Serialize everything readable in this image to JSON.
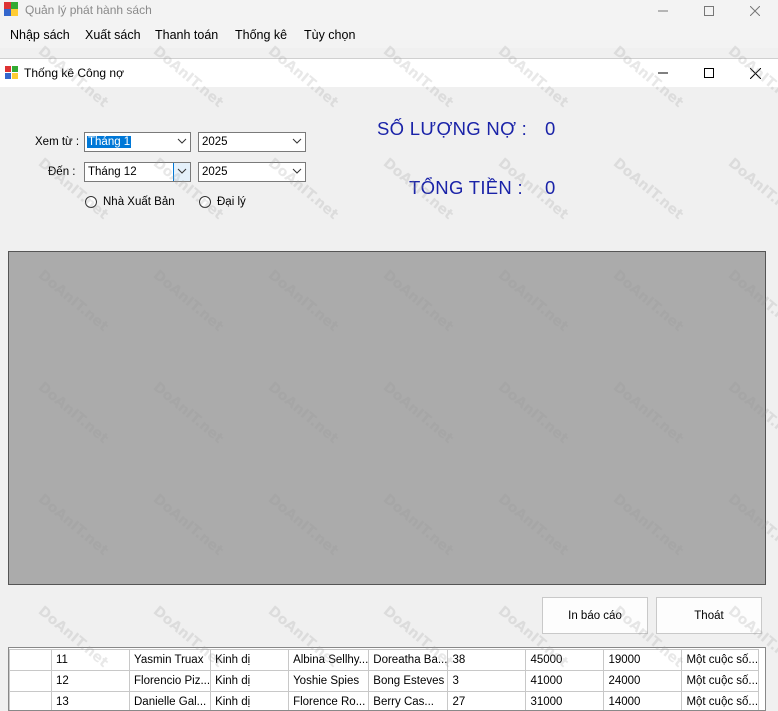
{
  "app": {
    "title": "Quản lý phát hành sách"
  },
  "menu": [
    "Nhập sách",
    "Xuất sách",
    "Thanh toán",
    "Thống kê",
    "Tùy chọn"
  ],
  "child": {
    "title": "Thống kê Công nợ"
  },
  "filter": {
    "from_label": "Xem từ :",
    "to_label": "Đến :",
    "from_month": "Tháng 1",
    "from_year": "2025",
    "to_month": "Tháng 12",
    "to_year": "2025",
    "radio_publisher": "Nhà Xuất Bản",
    "radio_agent": "Đại lý"
  },
  "summary": {
    "count_label": "SỐ LƯỢNG NỢ :",
    "count_value": "0",
    "total_label": "TỔNG TIỀN :",
    "total_value": "0"
  },
  "buttons": {
    "report": "In báo cáo",
    "exit": "Thoát"
  },
  "table": {
    "rows": [
      [
        "11",
        "Yasmin Truax",
        "Kinh dị",
        "Albina Sellhy...",
        "Doreatha Ba...",
        "38",
        "45000",
        "19000",
        "Một cuộc số..."
      ],
      [
        "12",
        "Florencio Piz...",
        "Kinh dị",
        "Yoshie Spies",
        "Bong Esteves",
        "3",
        "41000",
        "24000",
        "Một cuộc số..."
      ],
      [
        "13",
        "Danielle Gal...",
        "Kinh dị",
        "Florence Ro...",
        "Berry Cas...",
        "27",
        "31000",
        "14000",
        "Một cuộc số..."
      ]
    ]
  },
  "watermark": "DoAnIT.net"
}
